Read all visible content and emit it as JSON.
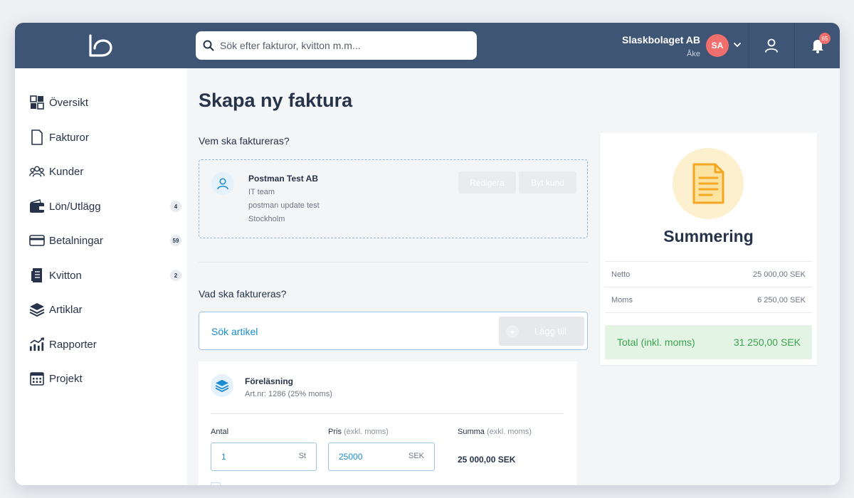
{
  "header": {
    "search_placeholder": "Sök efter fakturor, kvitton m.m...",
    "company_name": "Slaskbolaget AB",
    "user_name": "Åke",
    "avatar_initials": "SA",
    "notification_count": "65",
    "icons": [
      "logo",
      "search-icon",
      "chevron-down-icon",
      "user-icon",
      "bell-icon"
    ]
  },
  "sidebar": {
    "items": [
      {
        "label": "Översikt",
        "icon": "grid-icon",
        "badge": ""
      },
      {
        "label": "Fakturor",
        "icon": "document-icon",
        "badge": ""
      },
      {
        "label": "Kunder",
        "icon": "users-icon",
        "badge": ""
      },
      {
        "label": "Lön/Utlägg",
        "icon": "wallet-icon",
        "badge": "4"
      },
      {
        "label": "Betalningar",
        "icon": "card-icon",
        "badge": "59"
      },
      {
        "label": "Kvitton",
        "icon": "receipt-icon",
        "badge": "2"
      },
      {
        "label": "Artiklar",
        "icon": "layers-icon",
        "badge": ""
      },
      {
        "label": "Rapporter",
        "icon": "chart-icon",
        "badge": ""
      },
      {
        "label": "Projekt",
        "icon": "calendar-icon",
        "badge": ""
      }
    ]
  },
  "main": {
    "title": "Skapa ny faktura",
    "customer_section_label": "Vem ska faktureras?",
    "customer": {
      "name": "Postman Test AB",
      "line1": "IT team",
      "line2": "postman update test",
      "line3": "Stockholm",
      "edit_label": "Redigera",
      "change_label": "Byt kund"
    },
    "articles_section_label": "Vad ska faktureras?",
    "article_search_placeholder": "Sök artikel",
    "add_label": "Lägg till",
    "item": {
      "name": "Föreläsning",
      "sub": "Art.nr: 1286 (25% moms)",
      "qty_label": "Antal",
      "qty_value": "1",
      "qty_unit": "St",
      "price_label": "Pris",
      "price_note": "(exkl. moms)",
      "price_value": "25000",
      "price_unit": "SEK",
      "sum_label": "Summa",
      "sum_note": "(exkl. moms)",
      "sum_value": "25 000,00 SEK"
    }
  },
  "summary": {
    "title": "Summering",
    "net_label": "Netto",
    "net_value": "25 000,00 SEK",
    "vat_label": "Moms",
    "vat_value": "6 250,00 SEK",
    "total_label": "Total (inkl. moms)",
    "total_value": "31 250,00 SEK"
  },
  "colors": {
    "header_bg": "#3e5575",
    "accent_blue": "#1a8ccf",
    "badge_red": "#ef6f6c",
    "total_green": "#3ba24f",
    "total_bg": "#e3f4e4"
  }
}
